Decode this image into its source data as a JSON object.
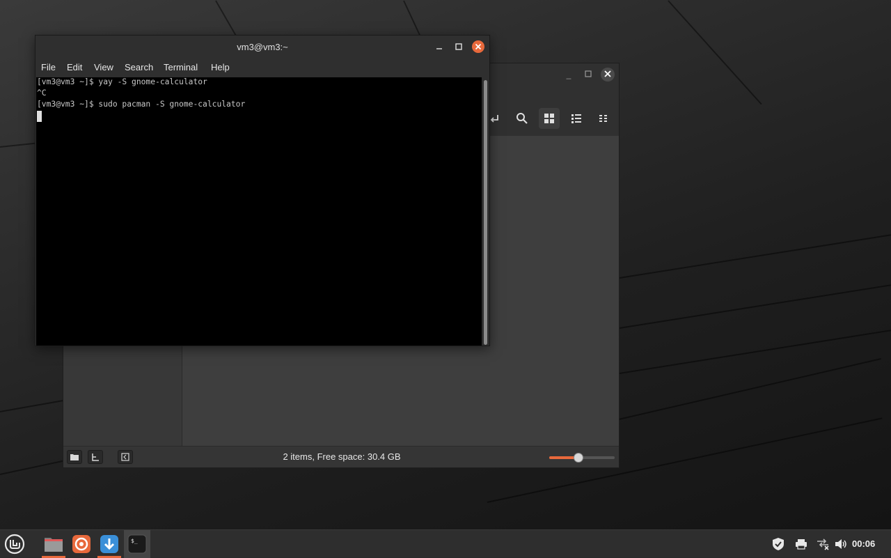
{
  "terminal": {
    "title": "vm3@vm3:~",
    "menu": [
      "File",
      "Edit",
      "View",
      "Search",
      "Terminal",
      "Help"
    ],
    "lines": [
      "[vm3@vm3 ~]$ yay -S gnome-calculator",
      "^C",
      "[vm3@vm3 ~]$ sudo pacman -S gnome-calculator"
    ]
  },
  "file_manager": {
    "status_text": "2 items, Free space: 30.4 GB",
    "zoom_level": 0.45
  },
  "taskbar": {
    "apps": [
      "linux-mint-menu-icon",
      "files-icon",
      "firefox-icon",
      "update-manager-icon",
      "terminal-icon"
    ],
    "clock": "00:06"
  },
  "colors": {
    "accent": "#e8693c",
    "terminal_bg": "#000000"
  }
}
